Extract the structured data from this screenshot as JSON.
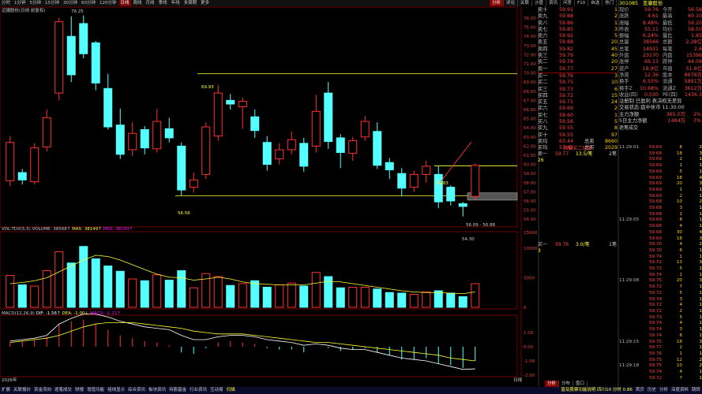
{
  "toolbar": {
    "left_tabs": [
      "分时",
      "1分钟",
      "5分钟",
      "15分钟",
      "30分钟",
      "60分钟",
      "120分钟",
      "日线",
      "周线",
      "月线",
      "季线",
      "年线",
      "多周期",
      "更多"
    ],
    "active": "日线",
    "right_tabs": [
      "分析",
      "评论",
      "关联",
      "沙盘",
      "资讯",
      "问答",
      "F10",
      "自选",
      "热门"
    ],
    "right_active": "分析"
  },
  "chart": {
    "title": "迈捷股份(日线 前复权)",
    "y_ticks": [
      "76.00",
      "75.00",
      "74.00",
      "73.00",
      "72.00",
      "71.00",
      "70.00",
      "69.00",
      "68.00",
      "67.00",
      "66.00",
      "65.00",
      "64.00",
      "63.00",
      "62.00",
      "61.00",
      "60.00",
      "59.00",
      "58.00",
      "57.00",
      "56.00",
      "55.00",
      "54.00"
    ],
    "annotations": {
      "high_top": "76.25",
      "upper_line": "69.93",
      "lower_line": "56.56",
      "box_top": "59.83",
      "box_range": "56.09 - 56.88",
      "low_bottom": "54.30"
    },
    "vol_info": {
      "label": "VOL-TDX(5,5)",
      "volume": "VOLUME: 38568↑",
      "ma5": "MA5: 38149↑",
      "ma5b": "MA5: 38149↑"
    },
    "vol_ticks": [
      "10000",
      "5000",
      "0",
      "15000"
    ],
    "macd_info": {
      "label": "MACD(12,26,9)",
      "dif": "DIF: -1.56↑",
      "dea": "DEA: -1.00↓",
      "macd": "MACD: -1.11↑"
    },
    "macd_ticks": [
      "1.00",
      "0.00",
      "-1.00",
      "-2.00"
    ],
    "date_label": "2026年",
    "footer_label": "日线"
  },
  "chart_data": {
    "type": "candlestick",
    "ylim": [
      53.5,
      76.6
    ],
    "candles": [
      {
        "o": 58.2,
        "c": 62.4,
        "h": 63.1,
        "l": 57.6
      },
      {
        "o": 59.1,
        "c": 58.3,
        "h": 59.5,
        "l": 57.8
      },
      {
        "o": 58.1,
        "c": 61.8,
        "h": 62.3,
        "l": 57.8
      },
      {
        "o": 61.9,
        "c": 65.1,
        "h": 66.0,
        "l": 61.4
      },
      {
        "o": 67.8,
        "c": 75.6,
        "h": 76.0,
        "l": 67.0
      },
      {
        "o": 74.0,
        "c": 69.8,
        "h": 76.2,
        "l": 69.0
      },
      {
        "o": 75.4,
        "c": 72.1,
        "h": 76.3,
        "l": 71.6
      },
      {
        "o": 73.3,
        "c": 68.9,
        "h": 73.5,
        "l": 68.1
      },
      {
        "o": 68.3,
        "c": 64.1,
        "h": 69.9,
        "l": 63.8
      },
      {
        "o": 64.3,
        "c": 61.1,
        "h": 66.1,
        "l": 60.6
      },
      {
        "o": 61.6,
        "c": 63.4,
        "h": 64.6,
        "l": 60.9
      },
      {
        "o": 63.8,
        "c": 61.8,
        "h": 64.2,
        "l": 61.1
      },
      {
        "o": 61.7,
        "c": 64.7,
        "h": 66.1,
        "l": 61.3
      },
      {
        "o": 63.9,
        "c": 62.9,
        "h": 65.1,
        "l": 62.4
      },
      {
        "o": 62.0,
        "c": 57.2,
        "h": 62.4,
        "l": 56.6
      },
      {
        "o": 57.5,
        "c": 58.3,
        "h": 59.1,
        "l": 56.9
      },
      {
        "o": 58.9,
        "c": 64.1,
        "h": 64.6,
        "l": 58.4
      },
      {
        "o": 63.1,
        "c": 67.8,
        "h": 68.7,
        "l": 62.6
      },
      {
        "o": 67.0,
        "c": 66.6,
        "h": 67.7,
        "l": 66.0
      },
      {
        "o": 66.3,
        "c": 66.9,
        "h": 67.3,
        "l": 63.9
      },
      {
        "o": 65.2,
        "c": 63.7,
        "h": 66.0,
        "l": 62.9
      },
      {
        "o": 62.4,
        "c": 60.0,
        "h": 63.1,
        "l": 59.3
      },
      {
        "o": 60.6,
        "c": 61.6,
        "h": 62.3,
        "l": 60.0
      },
      {
        "o": 61.6,
        "c": 62.7,
        "h": 63.6,
        "l": 61.1
      },
      {
        "o": 62.3,
        "c": 59.8,
        "h": 62.9,
        "l": 59.2
      },
      {
        "o": 62.0,
        "c": 65.8,
        "h": 67.6,
        "l": 61.3
      },
      {
        "o": 67.8,
        "c": 62.5,
        "h": 69.0,
        "l": 61.7
      },
      {
        "o": 62.9,
        "c": 61.3,
        "h": 63.3,
        "l": 59.6
      },
      {
        "o": 61.2,
        "c": 62.6,
        "h": 63.0,
        "l": 60.4
      },
      {
        "o": 63.0,
        "c": 64.7,
        "h": 65.3,
        "l": 62.6
      },
      {
        "o": 63.6,
        "c": 59.9,
        "h": 64.6,
        "l": 59.5
      },
      {
        "o": 60.2,
        "c": 59.4,
        "h": 60.7,
        "l": 58.4
      },
      {
        "o": 59.0,
        "c": 57.4,
        "h": 59.6,
        "l": 56.5
      },
      {
        "o": 57.5,
        "c": 58.9,
        "h": 59.3,
        "l": 57.0
      },
      {
        "o": 58.9,
        "c": 59.8,
        "h": 60.4,
        "l": 58.0
      },
      {
        "o": 58.9,
        "c": 55.9,
        "h": 59.8,
        "l": 55.2
      },
      {
        "o": 57.5,
        "c": 56.0,
        "h": 57.7,
        "l": 55.5
      },
      {
        "o": 55.7,
        "c": 55.4,
        "h": 55.9,
        "l": 54.3
      },
      {
        "o": 56.5,
        "c": 59.9,
        "h": 60.1,
        "l": 56.2
      }
    ],
    "volume": [
      5400,
      3800,
      3600,
      6200,
      9400,
      7500,
      10300,
      8200,
      7000,
      6100,
      4800,
      4500,
      5500,
      4600,
      6200,
      3300,
      5700,
      5200,
      3700,
      4000,
      4500,
      3400,
      3800,
      4100,
      3600,
      5900,
      5200,
      3300,
      3400,
      3400,
      3100,
      2500,
      2400,
      2200,
      2600,
      2800,
      2400,
      1800,
      4000
    ],
    "vol_ma": [
      4000,
      4200,
      4500,
      5000,
      6000,
      7000,
      8000,
      8800,
      8600,
      8000,
      7200,
      6400,
      5600,
      5100,
      5000,
      4600,
      4800,
      5100,
      4800,
      4300,
      4000,
      3900,
      3800,
      3800,
      3800,
      4100,
      4400,
      4300,
      4000,
      3700,
      3400,
      3100,
      2800,
      2600,
      2500,
      2500,
      2400,
      2300,
      2600
    ],
    "macd_hist": [
      0.3,
      0.4,
      0.5,
      0.7,
      1.6,
      1.8,
      1.9,
      1.6,
      1.2,
      0.8,
      0.6,
      0.4,
      0.3,
      0.1,
      -0.4,
      -0.5,
      -0.1,
      0.3,
      0.4,
      0.3,
      0.2,
      -0.1,
      -0.2,
      -0.2,
      -0.4,
      0.0,
      -0.1,
      -0.3,
      -0.2,
      -0.1,
      -0.4,
      -0.6,
      -0.9,
      -0.9,
      -0.8,
      -1.2,
      -1.3,
      -1.5,
      -1.0
    ],
    "dif": [
      0.4,
      0.5,
      0.6,
      0.8,
      1.6,
      2.0,
      2.3,
      2.3,
      2.1,
      1.8,
      1.6,
      1.4,
      1.3,
      1.2,
      0.8,
      0.5,
      0.5,
      0.7,
      0.8,
      0.8,
      0.7,
      0.5,
      0.4,
      0.3,
      0.1,
      0.2,
      0.1,
      -0.1,
      -0.2,
      -0.2,
      -0.4,
      -0.6,
      -0.8,
      -0.9,
      -1.0,
      -1.2,
      -1.4,
      -1.6,
      -1.56
    ],
    "dea": [
      0.3,
      0.4,
      0.5,
      0.6,
      0.8,
      1.1,
      1.4,
      1.6,
      1.7,
      1.7,
      1.7,
      1.6,
      1.5,
      1.4,
      1.3,
      1.1,
      1.0,
      0.9,
      0.9,
      0.9,
      0.8,
      0.7,
      0.6,
      0.5,
      0.4,
      0.3,
      0.3,
      0.2,
      0.1,
      0.0,
      -0.1,
      -0.2,
      -0.3,
      -0.4,
      -0.5,
      -0.6,
      -0.8,
      -0.9,
      -1.0
    ]
  },
  "orderbook": {
    "asks": [
      {
        "label": "卖十",
        "price": "59.91",
        "vol": "1"
      },
      {
        "label": "卖九",
        "price": "59.88",
        "vol": "2"
      },
      {
        "label": "卖八",
        "price": "59.86",
        "vol": "1"
      },
      {
        "label": "卖七",
        "price": "59.85",
        "vol": "3"
      },
      {
        "label": "卖六",
        "price": "59.92",
        "vol": "5"
      },
      {
        "label": "卖五",
        "price": "59.88",
        "vol": "20"
      },
      {
        "label": "卖四",
        "price": "59.82",
        "vol": "45"
      },
      {
        "label": "卖三",
        "price": "59.79",
        "vol": "40"
      },
      {
        "label": "卖二",
        "price": "59.78",
        "vol": "20"
      },
      {
        "label": "卖一",
        "price": "59.77",
        "vol": "27"
      }
    ],
    "bids": [
      {
        "label": "买一",
        "price": "59.76",
        "vol": "3"
      },
      {
        "label": "买二",
        "price": "59.75",
        "vol": "10"
      },
      {
        "label": "买三",
        "price": "59.73",
        "vol": "6"
      },
      {
        "label": "买四",
        "price": "59.72",
        "vol": "15"
      },
      {
        "label": "买五",
        "price": "59.71",
        "vol": "24"
      },
      {
        "label": "买六",
        "price": "59.69",
        "vol": "2"
      },
      {
        "label": "买七",
        "price": "59.60",
        "vol": "1"
      },
      {
        "label": "买八",
        "price": "59.56",
        "vol": "5"
      },
      {
        "label": "买九",
        "price": "59.55",
        "vol": "8"
      },
      {
        "label": "买十",
        "price": "59.55",
        "vol": "97"
      }
    ],
    "summary": [
      {
        "label": "卖均",
        "price": "63.44",
        "tag": "总卖",
        "val": "8660"
      },
      {
        "label": "买均",
        "price": "57.41",
        "tag": "总买",
        "val": "2029"
      }
    ],
    "gap_text": "首要买二挂单",
    "sell1_row": {
      "label": "卖一",
      "price": "59.77",
      "size": "13.5/笔",
      "count": "2笔",
      "extra": "26"
    },
    "buy1_row": {
      "label": "买一",
      "price": "59.76",
      "size": "3.0/笔",
      "count": "1笔",
      "extra": "3"
    }
  },
  "quote": {
    "code": "301085",
    "name": "亚康股份",
    "rows": [
      [
        "现价",
        "59.76",
        "今开",
        "56.58"
      ],
      [
        "涨跌",
        "4.61",
        "最高",
        "60.10"
      ],
      [
        "涨幅",
        "8.48%",
        "最低",
        "56.20"
      ],
      [
        "昨收",
        "55.11",
        "均价",
        "58.50"
      ],
      [
        "振幅",
        "6.24%",
        "量比",
        "1.85"
      ],
      [
        "总量",
        "38566",
        "总额",
        "2.28亿"
      ],
      [
        "总笔",
        "14931",
        "每笔",
        "2.6"
      ],
      [
        "外盘",
        "23170",
        "内盘",
        "15396"
      ],
      [
        "涨停",
        "66.13",
        "跌停",
        "44.09"
      ],
      [
        "资产",
        "18.9亿",
        "市值",
        "51.9亿"
      ],
      [
        "净资",
        "12.36",
        "股本",
        "8678万"
      ],
      [
        "换手",
        "6.55%",
        "流通",
        "5891万"
      ],
      [
        "换手Z",
        "10.68%",
        "流通Z",
        "3612万"
      ],
      [
        "收益(四)",
        "0.030",
        "PE(四)",
        "1436.3"
      ]
    ],
    "notes": [
      "注册制 已盈利 表决权无差异",
      "交易状态:盘中休市 11:30:00"
    ],
    "flow": [
      {
        "label": "主力净额",
        "val": "365.0万",
        "pct": "2%"
      },
      {
        "label": "5日主力净额",
        "val": "1484万",
        "pct": "7%"
      }
    ],
    "deal_title": "逐笔成交"
  },
  "ticks": [
    [
      "11:29:01",
      "59.69",
      "6",
      "2"
    ],
    [
      "",
      "59.68",
      "18",
      "3"
    ],
    [
      "",
      "59.69",
      "2",
      "1"
    ],
    [
      "",
      "59.69",
      "1",
      "1"
    ],
    [
      "",
      "59.69",
      "5",
      "1"
    ],
    [
      "",
      "59.69",
      "18",
      "4"
    ],
    [
      "",
      "59.69",
      "20",
      "3"
    ],
    [
      "",
      "59.69",
      "1",
      "1"
    ],
    [
      "",
      "59.69",
      "2",
      "1"
    ],
    [
      "",
      "59.68",
      "10",
      "2"
    ],
    [
      "",
      "59.68",
      "3",
      "1"
    ],
    [
      "",
      "59.68",
      "1",
      "1"
    ],
    [
      "11:29:05",
      "59.69",
      "8",
      "1"
    ],
    [
      "",
      "59.68",
      "4",
      "1"
    ],
    [
      "",
      "59.68",
      "30",
      "4"
    ],
    [
      "",
      "59.69",
      "18",
      "3"
    ],
    [
      "",
      "59.70",
      "4",
      "2"
    ],
    [
      "",
      "59.70",
      "6",
      "1"
    ],
    [
      "",
      "59.74",
      "1",
      "1"
    ],
    [
      "",
      "59.72",
      "13",
      "3"
    ],
    [
      "",
      "59.72",
      "5",
      "1"
    ],
    [
      "",
      "59.74",
      "1",
      "1"
    ],
    [
      "11:29:08",
      "59.75",
      "20",
      "3"
    ],
    [
      "",
      "59.72",
      "7",
      "1"
    ],
    [
      "",
      "59.72",
      "5",
      "1"
    ],
    [
      "",
      "59.74",
      "3",
      "1"
    ],
    [
      "",
      "59.72",
      "4",
      "1"
    ],
    [
      "",
      "59.72",
      "2",
      "1"
    ],
    [
      "",
      "59.73",
      "5",
      "1"
    ],
    [
      "",
      "59.74",
      "4",
      "1"
    ],
    [
      "",
      "59.74",
      "3",
      "1"
    ],
    [
      "",
      "59.74",
      "6",
      "1"
    ],
    [
      "11:29:15",
      "59.75",
      "18",
      "3"
    ],
    [
      "",
      "59.77",
      "2",
      "1"
    ],
    [
      "",
      "59.76",
      "1",
      "1"
    ],
    [
      "",
      "59.75",
      "12",
      "2"
    ],
    [
      "11:29:18",
      "59.75",
      "10",
      "2"
    ],
    [
      "",
      "59.74",
      "4",
      "1"
    ],
    [
      "",
      "59.72",
      "7",
      "1"
    ],
    [
      "",
      "59.72",
      "6",
      "1"
    ]
  ],
  "right_bottom": {
    "tabs": [
      "分析",
      "分布",
      "盘口"
    ]
  },
  "bottom": {
    "items": [
      "扩展",
      "关联报价",
      "资金流向",
      "逐笔成交",
      "财报",
      "增值功能",
      "组线显示",
      "综合资讯",
      "板块资讯",
      "持股基金",
      "行业资讯",
      "互动易",
      "扫描"
    ],
    "right_items": [
      "首页",
      "历史",
      "分析",
      "深度资料",
      "跳转"
    ],
    "highlight": "扫描",
    "index_text": "普及股票功能说明 四川10 分时 0.86"
  },
  "colors": {
    "up": "#ff3030",
    "down": "#54ffff",
    "ma": "#ffff30",
    "text": "#c0c0c0",
    "grid": "#700000"
  }
}
